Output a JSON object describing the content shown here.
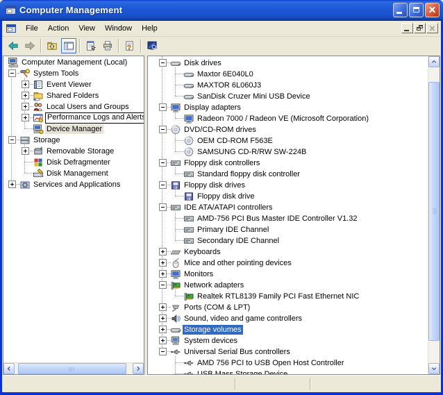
{
  "window": {
    "title": "Computer Management"
  },
  "titlebar": {
    "buttons": [
      {
        "name": "minimize-button"
      },
      {
        "name": "maximize-button"
      },
      {
        "name": "close-button"
      }
    ]
  },
  "menubar": {
    "items": [
      {
        "label": "File"
      },
      {
        "label": "Action"
      },
      {
        "label": "View"
      },
      {
        "label": "Window"
      },
      {
        "label": "Help"
      }
    ],
    "mdi_buttons": [
      {
        "name": "child-minimize-button"
      },
      {
        "name": "child-restore-button"
      },
      {
        "name": "child-close-button",
        "disabled": true
      }
    ]
  },
  "toolbar": {
    "buttons": [
      {
        "name": "back",
        "icon": "tb-back"
      },
      {
        "name": "forward",
        "icon": "tb-fwd",
        "disabled": true
      },
      {
        "sep": true
      },
      {
        "name": "up-one-level",
        "icon": "tb-up"
      },
      {
        "name": "show-hide-console-tree",
        "icon": "tb-tree",
        "pressed": true
      },
      {
        "sep": true
      },
      {
        "name": "properties",
        "icon": "tb-props"
      },
      {
        "name": "print",
        "icon": "tb-print"
      },
      {
        "sep": true
      },
      {
        "name": "help",
        "icon": "tb-help"
      },
      {
        "sep": true
      },
      {
        "name": "device-manager-snapin",
        "icon": "tb-devmgr"
      }
    ]
  },
  "left_tree": {
    "items": [
      {
        "label": "Computer Management (Local)",
        "depth": 0,
        "expand": "none",
        "icon": "computer"
      },
      {
        "label": "System Tools",
        "depth": 1,
        "expand": "minus",
        "icon": "systools"
      },
      {
        "label": "Event Viewer",
        "depth": 2,
        "expand": "plus",
        "icon": "eventvwr"
      },
      {
        "label": "Shared Folders",
        "depth": 2,
        "expand": "plus",
        "icon": "sharedfold"
      },
      {
        "label": "Local Users and Groups",
        "depth": 2,
        "expand": "plus",
        "icon": "users"
      },
      {
        "label": "Performance Logs and Alerts",
        "depth": 2,
        "expand": "plus",
        "icon": "perflogs",
        "state": "focus-box"
      },
      {
        "label": "Device Manager",
        "depth": 2,
        "expand": "none",
        "icon": "devmgr",
        "state": "inactive-selected"
      },
      {
        "label": "Storage",
        "depth": 1,
        "expand": "minus",
        "icon": "storage"
      },
      {
        "label": "Removable Storage",
        "depth": 2,
        "expand": "plus",
        "icon": "remstorage"
      },
      {
        "label": "Disk Defragmenter",
        "depth": 2,
        "expand": "none",
        "icon": "defrag"
      },
      {
        "label": "Disk Management",
        "depth": 2,
        "expand": "none",
        "icon": "diskmgmt"
      },
      {
        "label": "Services and Applications",
        "depth": 1,
        "expand": "plus",
        "icon": "services"
      }
    ]
  },
  "right_tree": {
    "items": [
      {
        "label": "Disk drives",
        "depth": 1,
        "expand": "minus",
        "icon": "hdd"
      },
      {
        "label": "Maxtor 6E040L0",
        "depth": 2,
        "expand": "none",
        "icon": "hdd"
      },
      {
        "label": "MAXTOR 6L060J3",
        "depth": 2,
        "expand": "none",
        "icon": "hdd"
      },
      {
        "label": "SanDisk Cruzer Mini USB Device",
        "depth": 2,
        "expand": "none",
        "icon": "hdd"
      },
      {
        "label": "Display adapters",
        "depth": 1,
        "expand": "minus",
        "icon": "display"
      },
      {
        "label": "Radeon 7000 / Radeon VE (Microsoft Corporation)",
        "depth": 2,
        "expand": "none",
        "icon": "display"
      },
      {
        "label": "DVD/CD-ROM drives",
        "depth": 1,
        "expand": "minus",
        "icon": "cd"
      },
      {
        "label": "OEM CD-ROM F563E",
        "depth": 2,
        "expand": "none",
        "icon": "cd"
      },
      {
        "label": "SAMSUNG CD-R/RW SW-224B",
        "depth": 2,
        "expand": "none",
        "icon": "cd"
      },
      {
        "label": "Floppy disk controllers",
        "depth": 1,
        "expand": "minus",
        "icon": "ctrl"
      },
      {
        "label": "Standard floppy disk controller",
        "depth": 2,
        "expand": "none",
        "icon": "ctrl"
      },
      {
        "label": "Floppy disk drives",
        "depth": 1,
        "expand": "minus",
        "icon": "floppy"
      },
      {
        "label": "Floppy disk drive",
        "depth": 2,
        "expand": "none",
        "icon": "floppy"
      },
      {
        "label": "IDE ATA/ATAPI controllers",
        "depth": 1,
        "expand": "minus",
        "icon": "ctrl"
      },
      {
        "label": "AMD-756 PCI Bus Master IDE Controller V1.32",
        "depth": 2,
        "expand": "none",
        "icon": "ctrl"
      },
      {
        "label": "Primary IDE Channel",
        "depth": 2,
        "expand": "none",
        "icon": "ctrl"
      },
      {
        "label": "Secondary IDE Channel",
        "depth": 2,
        "expand": "none",
        "icon": "ctrl"
      },
      {
        "label": "Keyboards",
        "depth": 1,
        "expand": "plus",
        "icon": "kbd"
      },
      {
        "label": "Mice and other pointing devices",
        "depth": 1,
        "expand": "plus",
        "icon": "mouse"
      },
      {
        "label": "Monitors",
        "depth": 1,
        "expand": "plus",
        "icon": "display"
      },
      {
        "label": "Network adapters",
        "depth": 1,
        "expand": "minus",
        "icon": "net"
      },
      {
        "label": "Realtek RTL8139 Family PCI Fast Ethernet NIC",
        "depth": 2,
        "expand": "none",
        "icon": "net"
      },
      {
        "label": "Ports (COM & LPT)",
        "depth": 1,
        "expand": "plus",
        "icon": "ports"
      },
      {
        "label": "Sound, video and game controllers",
        "depth": 1,
        "expand": "plus",
        "icon": "sound"
      },
      {
        "label": "Storage volumes",
        "depth": 1,
        "expand": "plus",
        "icon": "hdd",
        "state": "selected"
      },
      {
        "label": "System devices",
        "depth": 1,
        "expand": "plus",
        "icon": "sysdev"
      },
      {
        "label": "Universal Serial Bus controllers",
        "depth": 1,
        "expand": "minus",
        "icon": "usb"
      },
      {
        "label": "AMD 756 PCI to USB Open Host Controller",
        "depth": 2,
        "expand": "none",
        "icon": "usb"
      },
      {
        "label": "USB Mass Storage Device",
        "depth": 2,
        "expand": "none",
        "icon": "usb"
      }
    ]
  },
  "colors": {
    "selection": "#316ac5",
    "selection_text": "#ffffff",
    "inactive_selection": "#e6e3d6",
    "titlebar_blue": "#1c57d6",
    "window_border": "#0831d9",
    "chrome": "#ece9d8"
  }
}
